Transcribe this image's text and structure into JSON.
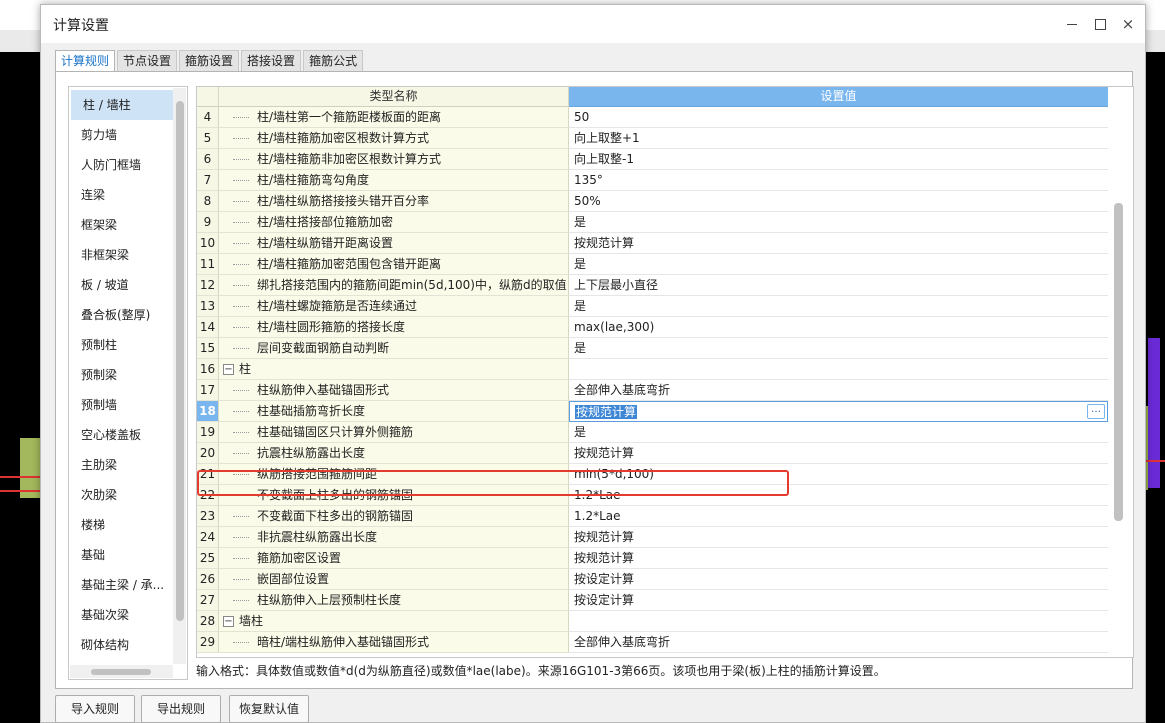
{
  "window": {
    "title": "计算设置"
  },
  "tabs": [
    "计算规则",
    "节点设置",
    "箍筋设置",
    "搭接设置",
    "箍筋公式"
  ],
  "left_list": [
    "柱 / 墙柱",
    "剪力墙",
    "人防门框墙",
    "连梁",
    "框架梁",
    "非框架梁",
    "板 / 坡道",
    "叠合板(整厚)",
    "预制柱",
    "预制梁",
    "预制墙",
    "空心楼盖板",
    "主肋梁",
    "次肋梁",
    "楼梯",
    "基础",
    "基础主梁 / 承...",
    "基础次梁",
    "砌体结构"
  ],
  "table": {
    "header_name": "类型名称",
    "header_value": "设置值",
    "rows": [
      {
        "idx": "4",
        "name": "柱/墙柱第一个箍筋距楼板面的距离",
        "value": "50"
      },
      {
        "idx": "5",
        "name": "柱/墙柱箍筋加密区根数计算方式",
        "value": "向上取整+1"
      },
      {
        "idx": "6",
        "name": "柱/墙柱箍筋非加密区根数计算方式",
        "value": "向上取整-1"
      },
      {
        "idx": "7",
        "name": "柱/墙柱箍筋弯勾角度",
        "value": "135°"
      },
      {
        "idx": "8",
        "name": "柱/墙柱纵筋搭接接头错开百分率",
        "value": "50%"
      },
      {
        "idx": "9",
        "name": "柱/墙柱搭接部位箍筋加密",
        "value": "是"
      },
      {
        "idx": "10",
        "name": "柱/墙柱纵筋错开距离设置",
        "value": "按规范计算"
      },
      {
        "idx": "11",
        "name": "柱/墙柱箍筋加密范围包含错开距离",
        "value": "是"
      },
      {
        "idx": "12",
        "name": "绑扎搭接范围内的箍筋间距min(5d,100)中，纵筋d的取值",
        "value": "上下层最小直径"
      },
      {
        "idx": "13",
        "name": "柱/墙柱螺旋箍筋是否连续通过",
        "value": "是"
      },
      {
        "idx": "14",
        "name": "柱/墙柱圆形箍筋的搭接长度",
        "value": "max(lae,300)"
      },
      {
        "idx": "15",
        "name": "层间变截面钢筋自动判断",
        "value": "是"
      },
      {
        "idx": "16",
        "name": "柱",
        "value": "",
        "group": true
      },
      {
        "idx": "17",
        "name": "柱纵筋伸入基础锚固形式",
        "value": "全部伸入基底弯折"
      },
      {
        "idx": "18",
        "name": "柱基础插筋弯折长度",
        "value": "按规范计算",
        "selected": true
      },
      {
        "idx": "19",
        "name": "柱基础锚固区只计算外侧箍筋",
        "value": "是"
      },
      {
        "idx": "20",
        "name": "抗震柱纵筋露出长度",
        "value": "按规范计算"
      },
      {
        "idx": "21",
        "name": "纵筋搭接范围箍筋间距",
        "value": "min(5*d,100)"
      },
      {
        "idx": "22",
        "name": "不变截面上柱多出的钢筋锚固",
        "value": "1.2*Lae"
      },
      {
        "idx": "23",
        "name": "不变截面下柱多出的钢筋锚固",
        "value": "1.2*Lae"
      },
      {
        "idx": "24",
        "name": "非抗震柱纵筋露出长度",
        "value": "按规范计算"
      },
      {
        "idx": "25",
        "name": "箍筋加密区设置",
        "value": "按规范计算"
      },
      {
        "idx": "26",
        "name": "嵌固部位设置",
        "value": "按设定计算"
      },
      {
        "idx": "27",
        "name": "柱纵筋伸入上层预制柱长度",
        "value": "按设定计算"
      },
      {
        "idx": "28",
        "name": "墙柱",
        "value": "",
        "group": true
      },
      {
        "idx": "29",
        "name": "暗柱/端柱纵筋伸入基础锚固形式",
        "value": "全部伸入基底弯折"
      }
    ]
  },
  "hint": "输入格式：具体数值或数值*d(d为纵筋直径)或数值*lae(labe)。来源16G101-3第66页。该项也用于梁(板)上柱的插筋计算设置。",
  "buttons": {
    "import": "导入规则",
    "export": "导出规则",
    "restore": "恢复默认值"
  },
  "icons": {
    "ellipsis": "…",
    "minimize": "minimize-icon",
    "maximize": "maximize-icon",
    "close": "×",
    "collapse": "−"
  },
  "colors": {
    "accent": "#1a73c9",
    "header_value_bg": "#7ab6ee",
    "highlight_border": "#e53a2e",
    "name_col_bg": "#fbfbe9"
  }
}
